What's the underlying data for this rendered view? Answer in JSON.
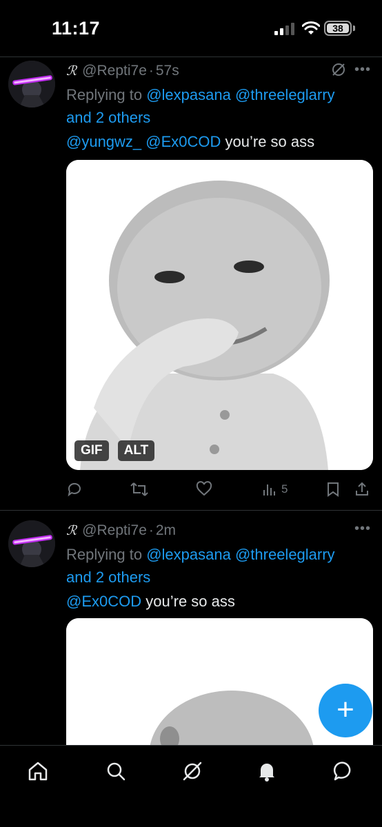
{
  "status_bar": {
    "time": "11:17",
    "battery": "38"
  },
  "tweets": [
    {
      "author_mark": "ℛ",
      "handle": "@Repti7e",
      "separator": "·",
      "time": "57s",
      "replying_prefix": "Replying to",
      "replying_mentions": "@lexpasana @threeleglarry",
      "replying_others": "and 2 others",
      "text_mentions": "@yungwz_ @Ex0COD",
      "text": " you’re so ass",
      "media_badges": [
        "GIF",
        "ALT"
      ],
      "views": "5"
    },
    {
      "author_mark": "ℛ",
      "handle": "@Repti7e",
      "separator": "·",
      "time": "2m",
      "replying_prefix": "Replying to",
      "replying_mentions": "@lexpasana @threeleglarry",
      "replying_others": "and 2 others",
      "text_mentions": "@Ex0COD",
      "text": " you’re so ass"
    }
  ],
  "fab": {
    "label": "+"
  },
  "colors": {
    "accent": "#1d9bf0",
    "background": "#000000",
    "muted": "#71767b"
  }
}
